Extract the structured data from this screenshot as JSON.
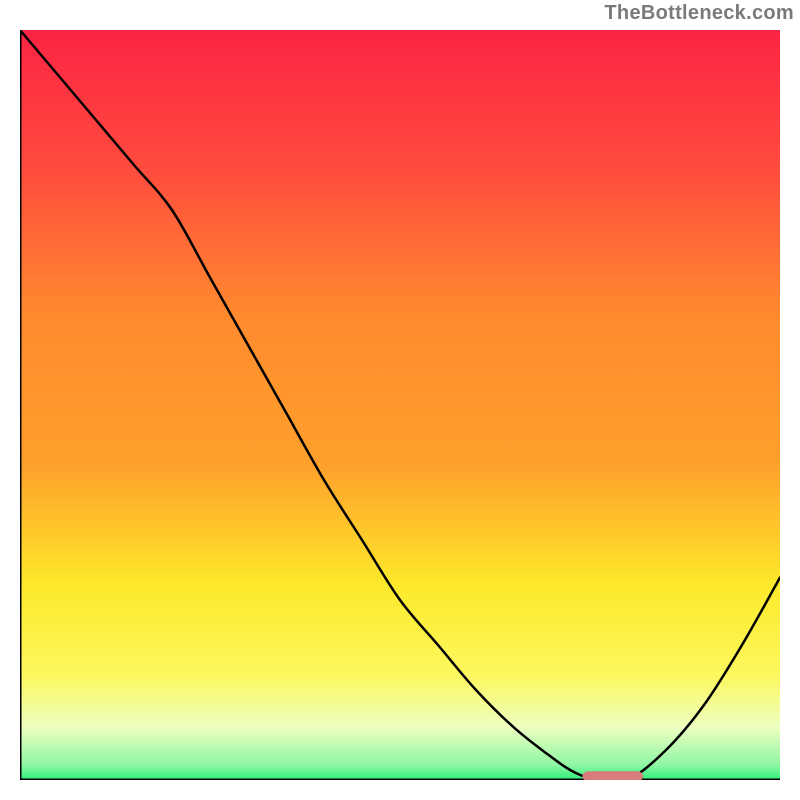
{
  "watermark": "TheBottleneck.com",
  "colors": {
    "gradient_top": "#fb2443",
    "gradient_mid1": "#ff5b3a",
    "gradient_mid2": "#ffa02b",
    "gradient_mid3": "#ffd918",
    "gradient_mid4": "#fdf85e",
    "gradient_mid5": "#f7ffb6",
    "gradient_bottom": "#2cef7a",
    "curve": "#000000",
    "marker": "#d87b7b"
  },
  "chart_data": {
    "type": "line",
    "title": "",
    "xlabel": "",
    "ylabel": "",
    "xlim": [
      0,
      100
    ],
    "ylim": [
      0,
      100
    ],
    "grid": false,
    "legend": false,
    "series": [
      {
        "name": "bottleneck-curve",
        "x": [
          0,
          5,
          10,
          15,
          20,
          25,
          30,
          35,
          40,
          45,
          50,
          55,
          60,
          65,
          70,
          73,
          76,
          80,
          85,
          90,
          95,
          100
        ],
        "y": [
          100,
          94,
          88,
          82,
          76,
          67,
          58,
          49,
          40,
          32,
          24,
          18,
          12,
          7,
          3,
          1,
          0,
          0,
          4,
          10,
          18,
          27
        ]
      }
    ],
    "annotations": [
      {
        "name": "optimal-marker",
        "kind": "rounded-bar",
        "x_center": 78,
        "y_center": 0.5,
        "width": 8,
        "height": 1.2,
        "color": "#d87b7b"
      }
    ]
  }
}
